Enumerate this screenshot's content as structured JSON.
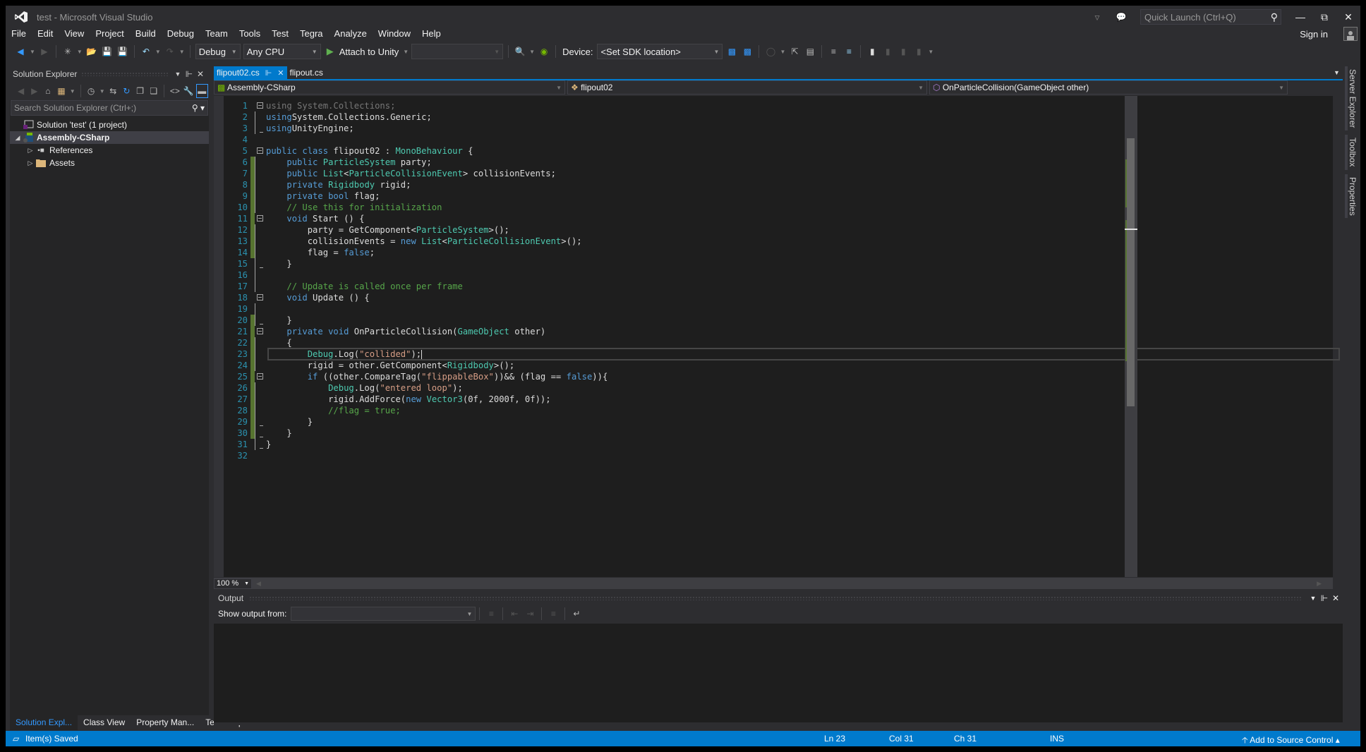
{
  "window": {
    "title": "test - Microsoft Visual Studio",
    "quick_launch_placeholder": "Quick Launch (Ctrl+Q)",
    "sign_in": "Sign in"
  },
  "menu": [
    "File",
    "Edit",
    "View",
    "Project",
    "Build",
    "Debug",
    "Team",
    "Tools",
    "Test",
    "Tegra",
    "Analyze",
    "Window",
    "Help"
  ],
  "toolbar": {
    "configuration": "Debug",
    "platform": "Any CPU",
    "attach_label": "Attach to Unity",
    "attach_target": "",
    "device_label": "Device:",
    "device_value": "<Set SDK location>"
  },
  "solution_explorer": {
    "title": "Solution Explorer",
    "search_placeholder": "Search Solution Explorer (Ctrl+;)",
    "tree": [
      {
        "label": "Solution 'test' (1 project)",
        "level": 0,
        "expander": "",
        "icon": "solution-icon"
      },
      {
        "label": "Assembly-CSharp",
        "level": 0,
        "expander": "expanded",
        "icon": "csharp-project-icon",
        "selected": true
      },
      {
        "label": "References",
        "level": 1,
        "expander": "collapsed",
        "icon": "references-icon"
      },
      {
        "label": "Assets",
        "level": 1,
        "expander": "collapsed",
        "icon": "folder-icon"
      }
    ],
    "bottom_tabs": [
      {
        "label": "Solution Expl...",
        "active": true
      },
      {
        "label": "Class View",
        "active": false
      },
      {
        "label": "Property Man...",
        "active": false
      },
      {
        "label": "Team Explorer",
        "active": false
      }
    ]
  },
  "document_tabs": [
    {
      "label": "flipout02.cs",
      "active": true
    },
    {
      "label": "flipout.cs",
      "active": false
    }
  ],
  "navigation": {
    "project": "Assembly-CSharp",
    "type": "flipout02",
    "member": "OnParticleCollision(GameObject other)"
  },
  "editor": {
    "current_line": 23,
    "lines": [
      {
        "n": 1,
        "fold": "open",
        "indent": 0,
        "chg": false,
        "tokens": [
          [
            "g",
            "using System.Collections;"
          ]
        ]
      },
      {
        "n": 2,
        "fold": "bar",
        "indent": 0,
        "chg": false,
        "tokens": [
          [
            "k",
            "using"
          ],
          [
            "",
            "System.Collections.Generic;"
          ]
        ]
      },
      {
        "n": 3,
        "fold": "end",
        "indent": 0,
        "chg": false,
        "tokens": [
          [
            "k",
            "using"
          ],
          [
            "",
            "UnityEngine;"
          ]
        ]
      },
      {
        "n": 4,
        "fold": "",
        "indent": 0,
        "chg": false,
        "tokens": []
      },
      {
        "n": 5,
        "fold": "open",
        "indent": 0,
        "chg": false,
        "tokens": [
          [
            "k",
            "public"
          ],
          [
            "k",
            " class"
          ],
          [
            "",
            " flipout02 : "
          ],
          [
            "t",
            "MonoBehaviour"
          ],
          [
            "",
            " {"
          ]
        ]
      },
      {
        "n": 6,
        "fold": "bar",
        "indent": 1,
        "chg": true,
        "tokens": [
          [
            "k",
            "public"
          ],
          [
            " ",
            ""
          ],
          [
            "t",
            "ParticleSystem"
          ],
          [
            "",
            " party;"
          ]
        ]
      },
      {
        "n": 7,
        "fold": "bar",
        "indent": 1,
        "chg": true,
        "tokens": [
          [
            "k",
            "public"
          ],
          [
            " ",
            ""
          ],
          [
            "t",
            "List"
          ],
          [
            "",
            "<"
          ],
          [
            "t",
            "ParticleCollisionEvent"
          ],
          [
            "",
            "> collisionEvents;"
          ]
        ]
      },
      {
        "n": 8,
        "fold": "bar",
        "indent": 1,
        "chg": true,
        "tokens": [
          [
            "k",
            "private"
          ],
          [
            " ",
            ""
          ],
          [
            "t",
            "Rigidbody"
          ],
          [
            "",
            " rigid;"
          ]
        ]
      },
      {
        "n": 9,
        "fold": "bar",
        "indent": 1,
        "chg": true,
        "tokens": [
          [
            "k",
            "private"
          ],
          [
            "k",
            " bool"
          ],
          [
            "",
            " flag;"
          ]
        ]
      },
      {
        "n": 10,
        "fold": "bar",
        "indent": 1,
        "chg": true,
        "tokens": [
          [
            "c",
            "// Use this for initialization"
          ]
        ]
      },
      {
        "n": 11,
        "fold": "open",
        "indent": 1,
        "chg": true,
        "tokens": [
          [
            "k",
            "void"
          ],
          [
            "",
            " Start () {"
          ]
        ]
      },
      {
        "n": 12,
        "fold": "bar",
        "indent": 2,
        "chg": true,
        "tokens": [
          [
            "",
            "party = GetComponent<"
          ],
          [
            "t",
            "ParticleSystem"
          ],
          [
            "",
            ">();"
          ]
        ]
      },
      {
        "n": 13,
        "fold": "bar",
        "indent": 2,
        "chg": true,
        "tokens": [
          [
            "",
            "collisionEvents = "
          ],
          [
            "k",
            "new"
          ],
          [
            " ",
            ""
          ],
          [
            "t",
            "List"
          ],
          [
            "",
            "<"
          ],
          [
            "t",
            "ParticleCollisionEvent"
          ],
          [
            "",
            ">();"
          ]
        ]
      },
      {
        "n": 14,
        "fold": "bar",
        "indent": 2,
        "chg": true,
        "tokens": [
          [
            "",
            "flag = "
          ],
          [
            "k",
            "false"
          ],
          [
            "",
            ";"
          ]
        ]
      },
      {
        "n": 15,
        "fold": "end",
        "indent": 1,
        "chg": false,
        "tokens": [
          [
            "",
            "}"
          ]
        ]
      },
      {
        "n": 16,
        "fold": "bar",
        "indent": 0,
        "chg": false,
        "tokens": []
      },
      {
        "n": 17,
        "fold": "bar",
        "indent": 1,
        "chg": false,
        "tokens": [
          [
            "c",
            "// Update is called once per frame"
          ]
        ]
      },
      {
        "n": 18,
        "fold": "open",
        "indent": 1,
        "chg": false,
        "tokens": [
          [
            "k",
            "void"
          ],
          [
            "",
            " Update () {"
          ]
        ]
      },
      {
        "n": 19,
        "fold": "bar",
        "indent": 2,
        "chg": false,
        "tokens": []
      },
      {
        "n": 20,
        "fold": "end",
        "indent": 1,
        "chg": true,
        "tokens": [
          [
            "",
            "}"
          ]
        ]
      },
      {
        "n": 21,
        "fold": "open",
        "indent": 1,
        "chg": true,
        "tokens": [
          [
            "k",
            "private"
          ],
          [
            "k",
            " void"
          ],
          [
            "",
            " OnParticleCollision("
          ],
          [
            "t",
            "GameObject"
          ],
          [
            "",
            " other)"
          ]
        ]
      },
      {
        "n": 22,
        "fold": "bar",
        "indent": 1,
        "chg": true,
        "tokens": [
          [
            "",
            "{"
          ]
        ]
      },
      {
        "n": 23,
        "fold": "bar",
        "indent": 2,
        "chg": true,
        "tokens": [
          [
            "t",
            "Debug"
          ],
          [
            "",
            ".Log("
          ],
          [
            "s",
            "\"collided\""
          ],
          [
            "",
            ");"
          ]
        ]
      },
      {
        "n": 24,
        "fold": "bar",
        "indent": 2,
        "chg": true,
        "tokens": [
          [
            "",
            "rigid = other.GetComponent<"
          ],
          [
            "t",
            "Rigidbody"
          ],
          [
            "",
            ">();"
          ]
        ]
      },
      {
        "n": 25,
        "fold": "open",
        "indent": 2,
        "chg": true,
        "tokens": [
          [
            "k",
            "if"
          ],
          [
            "",
            " ((other.CompareTag("
          ],
          [
            "s",
            "\"flippableBox\""
          ],
          [
            "",
            "))&& (flag == "
          ],
          [
            "k",
            "false"
          ],
          [
            "",
            "))"
          ],
          [
            "",
            "{"
          ]
        ]
      },
      {
        "n": 26,
        "fold": "bar",
        "indent": 3,
        "chg": true,
        "tokens": [
          [
            "t",
            "Debug"
          ],
          [
            "",
            ".Log("
          ],
          [
            "s",
            "\"entered loop\""
          ],
          [
            "",
            ");"
          ]
        ]
      },
      {
        "n": 27,
        "fold": "bar",
        "indent": 3,
        "chg": true,
        "tokens": [
          [
            "",
            "rigid.AddForce("
          ],
          [
            "k",
            "new"
          ],
          [
            " ",
            ""
          ],
          [
            "t",
            "Vector3"
          ],
          [
            "",
            "(0f, 2000f, 0f));"
          ]
        ]
      },
      {
        "n": 28,
        "fold": "bar",
        "indent": 3,
        "chg": true,
        "tokens": [
          [
            "c",
            "//flag = true;"
          ]
        ]
      },
      {
        "n": 29,
        "fold": "end",
        "indent": 2,
        "chg": true,
        "tokens": [
          [
            "",
            "}"
          ]
        ]
      },
      {
        "n": 30,
        "fold": "end",
        "indent": 1,
        "chg": true,
        "tokens": [
          [
            "",
            "}"
          ]
        ]
      },
      {
        "n": 31,
        "fold": "end",
        "indent": 0,
        "chg": false,
        "tokens": [
          [
            "",
            "}"
          ]
        ]
      },
      {
        "n": 32,
        "fold": "",
        "indent": 0,
        "chg": false,
        "tokens": []
      }
    ],
    "zoom": "100 %"
  },
  "output": {
    "title": "Output",
    "show_output_from_label": "Show output from:",
    "show_output_from_value": ""
  },
  "right_strip": [
    "Server Explorer",
    "Toolbox",
    "Properties"
  ],
  "status": {
    "message": "Item(s) Saved",
    "line": "Ln 23",
    "col": "Col 31",
    "ch": "Ch 31",
    "mode": "INS",
    "source_control": "Add to Source Control"
  },
  "colors": {
    "accent": "#007acc",
    "keyword": "#569cd6",
    "type": "#4ec9b0",
    "comment": "#57a64a",
    "string": "#d69d85",
    "line_number": "#2b91af",
    "change_marker": "#577430"
  }
}
